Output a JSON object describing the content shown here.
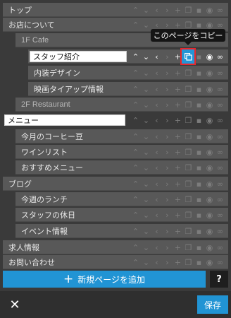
{
  "tree": {
    "rows": [
      {
        "label": "トップ"
      },
      {
        "label": "お店について"
      },
      {
        "label": "1F Cafe"
      },
      {
        "label": "スタッフ紹介"
      },
      {
        "label": "内装デザイン"
      },
      {
        "label": "映画タイアップ情報"
      },
      {
        "label": "2F Restaurant"
      },
      {
        "label": "メニュー"
      },
      {
        "label": "今月のコーヒー豆"
      },
      {
        "label": "ワインリスト"
      },
      {
        "label": "おすすめメニュー"
      },
      {
        "label": "ブログ"
      },
      {
        "label": "今週のランチ"
      },
      {
        "label": "スタッフの休日"
      },
      {
        "label": "イベント情報"
      },
      {
        "label": "求人情報"
      },
      {
        "label": "お問い合わせ"
      }
    ]
  },
  "tooltip": {
    "text": "このページをコピー"
  },
  "actions": {
    "add_page_label": "新規ページを追加",
    "help_label": "?",
    "close_label": "✕",
    "save_label": "保存"
  },
  "icons": [
    "chevron-up-icon",
    "chevron-down-icon",
    "chevron-left-icon",
    "chevron-right-icon",
    "plus-icon",
    "copy-icon",
    "trash-icon",
    "eye-icon",
    "link-icon"
  ],
  "colors": {
    "accent": "#2194d4",
    "highlight_border": "#e8262b",
    "row_bg": "#585858"
  }
}
